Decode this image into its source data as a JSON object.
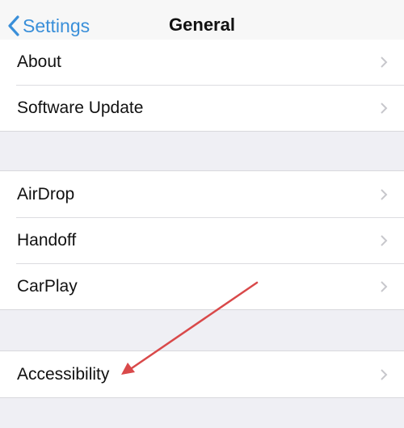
{
  "navbar": {
    "back_label": "Settings",
    "title": "General"
  },
  "groups": [
    {
      "items": [
        {
          "label": "About"
        },
        {
          "label": "Software Update"
        }
      ]
    },
    {
      "items": [
        {
          "label": "AirDrop"
        },
        {
          "label": "Handoff"
        },
        {
          "label": "CarPlay"
        }
      ]
    },
    {
      "items": [
        {
          "label": "Accessibility"
        }
      ]
    }
  ],
  "annotation": {
    "type": "arrow",
    "target": "Accessibility",
    "color": "#d9494a"
  },
  "colors": {
    "accent": "#3a8fd9",
    "background": "#efeff4",
    "chevron": "#c7c7cc"
  }
}
